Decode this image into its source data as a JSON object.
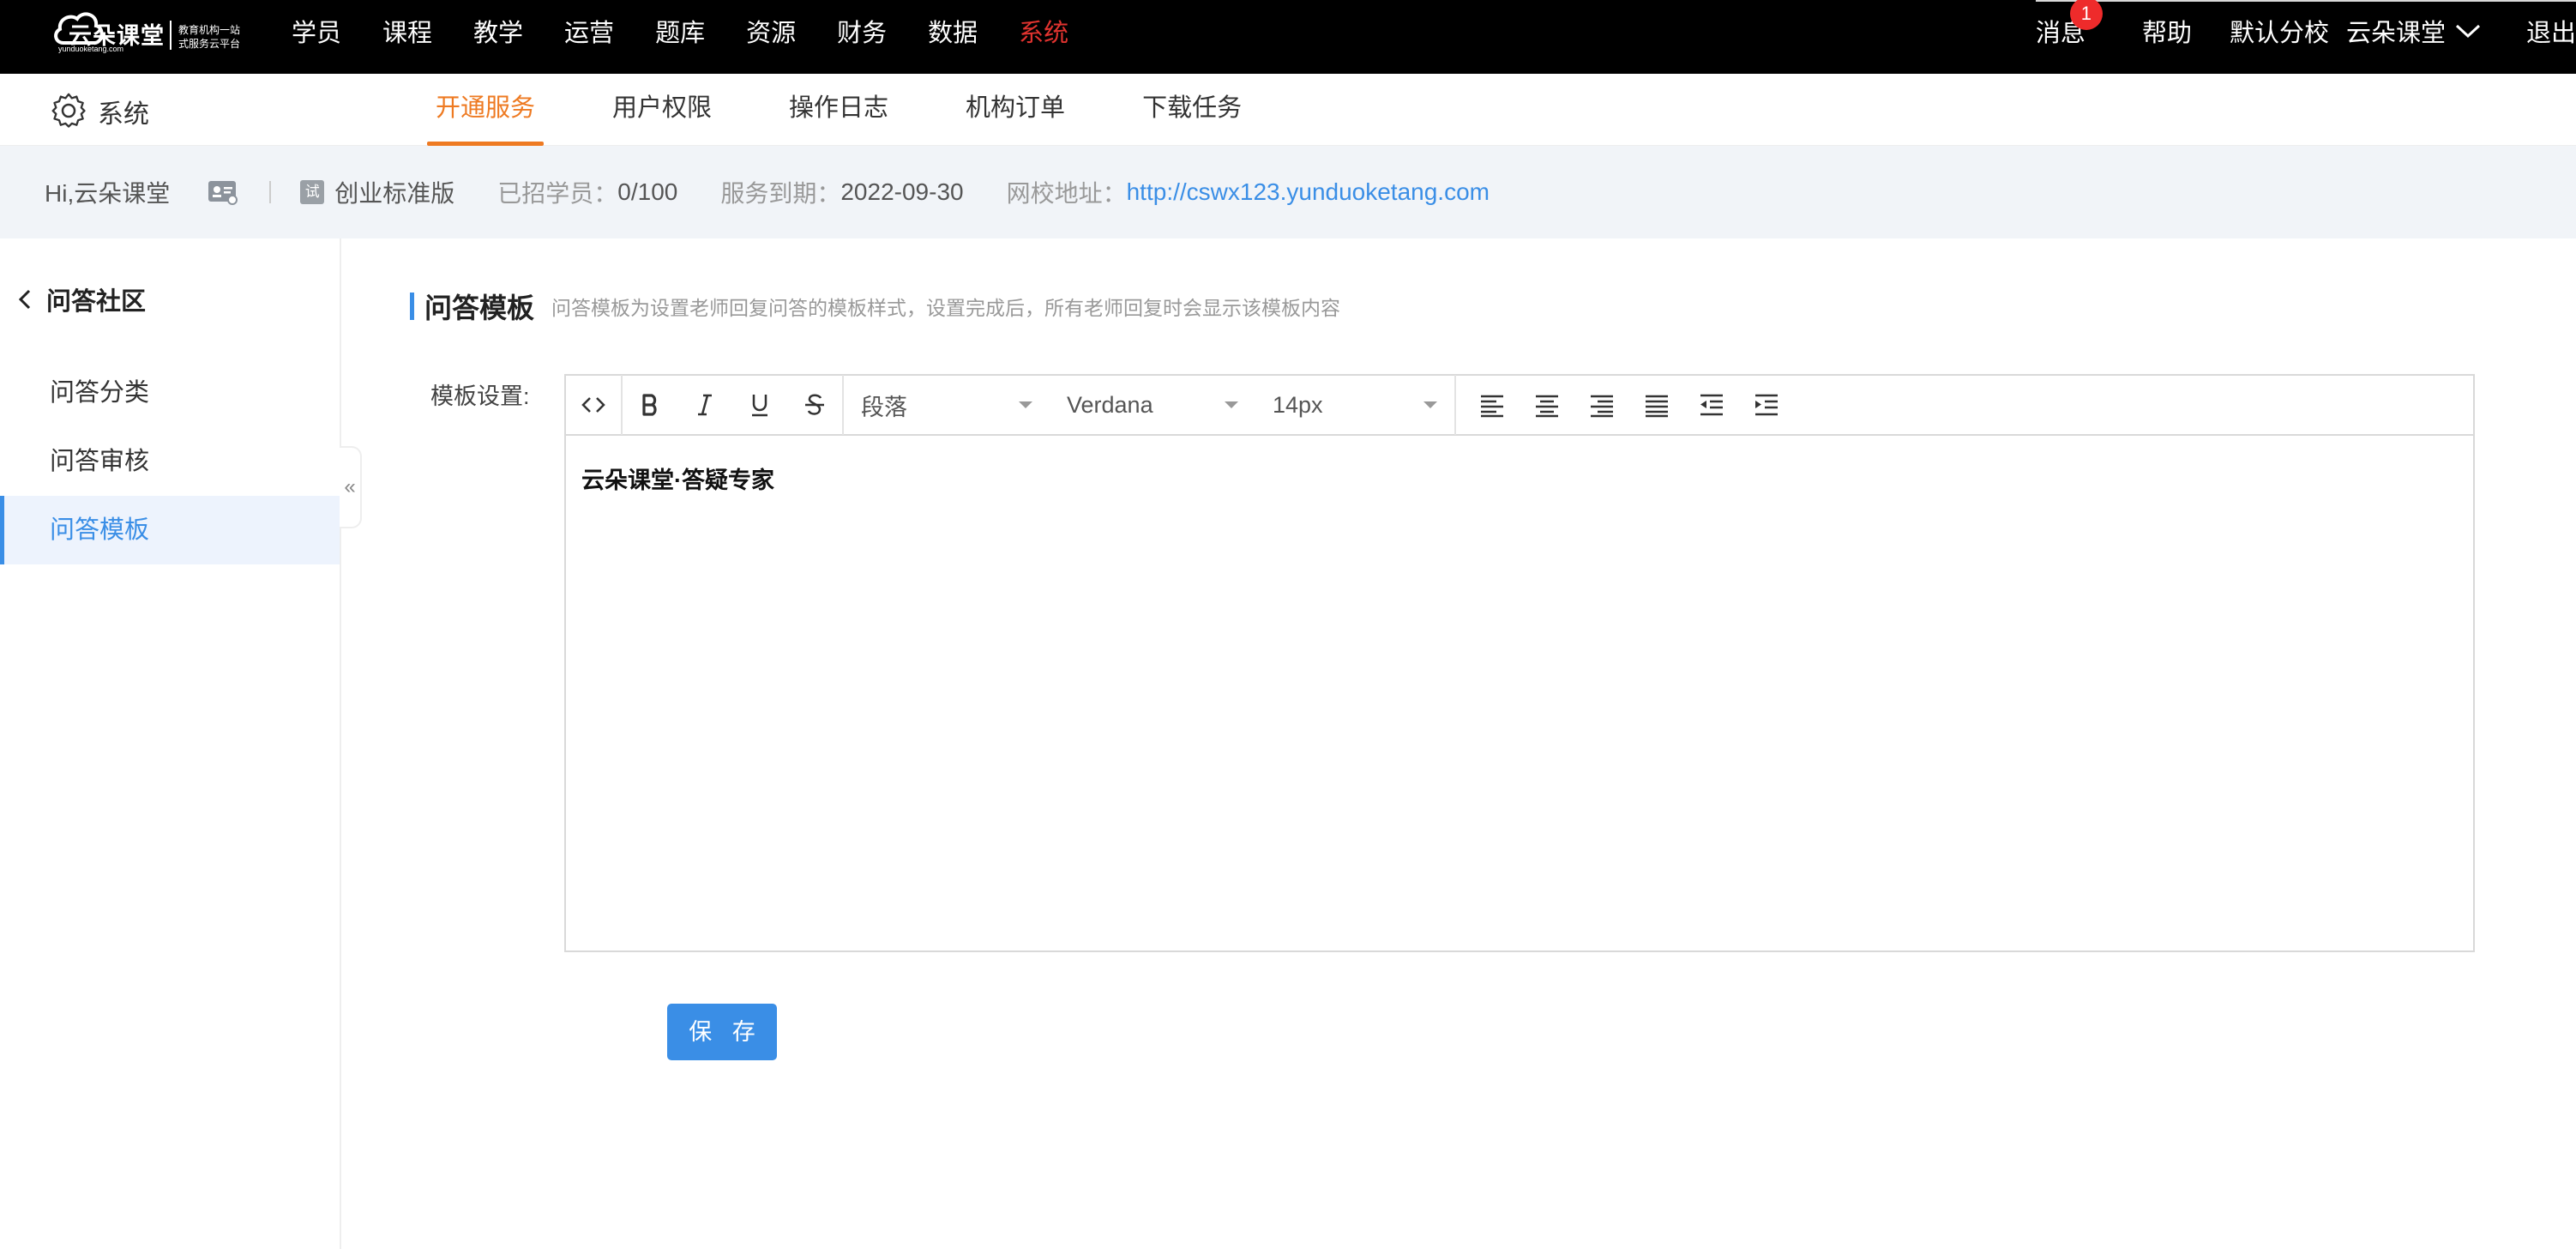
{
  "logo": {
    "name": "云朵课堂",
    "url_text": "yunduoketang.com",
    "tagline_1": "教育机构一站",
    "tagline_2": "式服务云平台"
  },
  "main_nav": {
    "items": [
      {
        "label": "学员"
      },
      {
        "label": "课程"
      },
      {
        "label": "教学"
      },
      {
        "label": "运营"
      },
      {
        "label": "题库"
      },
      {
        "label": "资源"
      },
      {
        "label": "财务"
      },
      {
        "label": "数据"
      },
      {
        "label": "系统",
        "active": true
      }
    ],
    "active_color": "#e0332f"
  },
  "top_right": {
    "messages_label": "消息",
    "messages_count": "1",
    "help_label": "帮助",
    "branch_label": "默认分校",
    "user_label": "云朵课堂",
    "logout_label": "退出"
  },
  "sub_nav": {
    "section_label": "系统",
    "tabs": [
      {
        "label": "开通服务",
        "active": true
      },
      {
        "label": "用户权限"
      },
      {
        "label": "操作日志"
      },
      {
        "label": "机构订单"
      },
      {
        "label": "下载任务"
      }
    ],
    "active_color": "#ee7a22"
  },
  "info_bar": {
    "greeting": "Hi,云朵课堂",
    "trial_badge": "试",
    "plan": "创业标准版",
    "students_label": "已招学员：",
    "students_value": "0/100",
    "expiry_label": "服务到期：",
    "expiry_value": "2022-09-30",
    "site_label": "网校地址：",
    "site_url": "http://cswx123.yunduoketang.com"
  },
  "sidebar": {
    "back_title": "问答社区",
    "items": [
      {
        "label": "问答分类"
      },
      {
        "label": "问答审核"
      },
      {
        "label": "问答模板",
        "active": true
      }
    ],
    "collapse_glyph": "«"
  },
  "content": {
    "section_title": "问答模板",
    "section_desc": "问答模板为设置老师回复问答的模板样式，设置完成后，所有老师回复时会显示该模板内容",
    "field_label": "模板设置:",
    "editor": {
      "toolbar": {
        "source_icon": "code-icon",
        "bold_icon": "bold-icon",
        "italic_icon": "italic-icon",
        "underline_icon": "underline-icon",
        "strike_icon": "strikethrough-icon",
        "paragraph_value": "段落",
        "font_value": "Verdana",
        "size_value": "14px",
        "align_icons": [
          "align-left-icon",
          "align-center-icon",
          "align-right-icon",
          "align-justify-icon",
          "outdent-icon",
          "indent-icon"
        ]
      },
      "content": "云朵课堂·答疑专家"
    },
    "save_label": "保 存"
  },
  "colors": {
    "primary": "#3a8ee6",
    "topbar_bg": "#000000",
    "info_bg": "#f1f4f8",
    "badge": "#ee2b2b"
  }
}
